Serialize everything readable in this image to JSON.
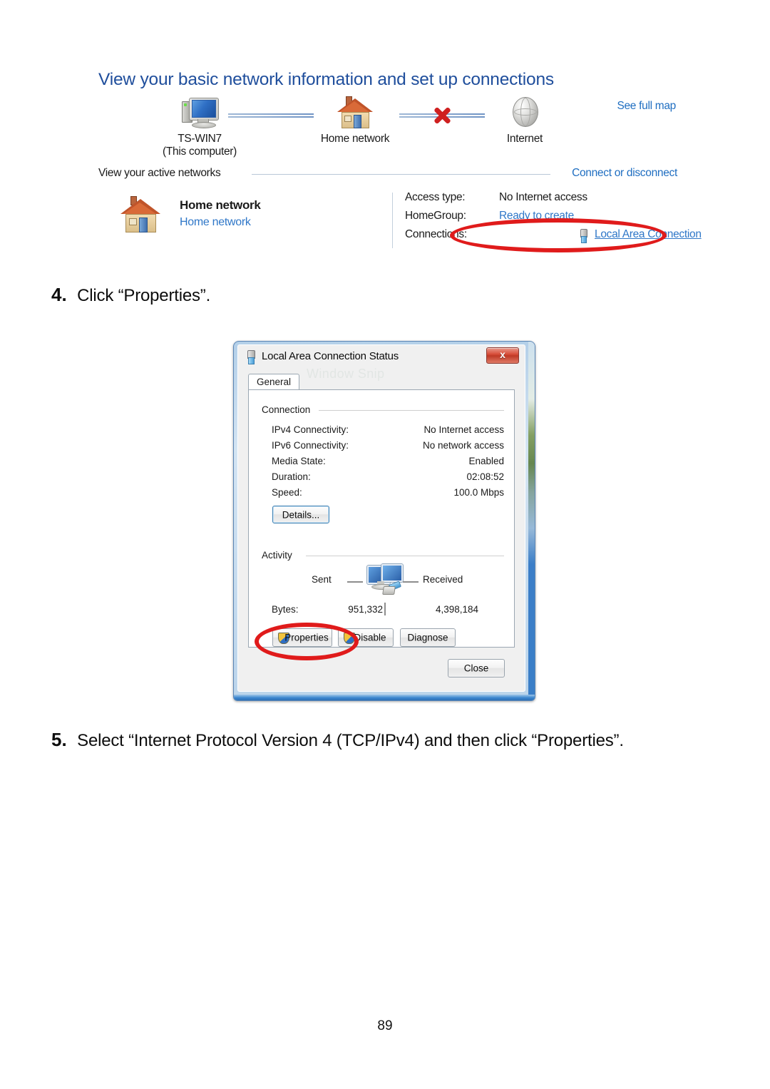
{
  "document": {
    "page_number": "89"
  },
  "network_center": {
    "heading": "View your basic network information and set up connections",
    "see_full_map": "See full map",
    "map_nodes": [
      {
        "icon": "computer-icon",
        "label": "TS-WIN7",
        "sublabel": "(This computer)"
      },
      {
        "icon": "house-icon",
        "label": "Home network",
        "sublabel": ""
      },
      {
        "icon": "globe-icon",
        "label": "Internet",
        "sublabel": ""
      }
    ],
    "connection_broken_marker": "red-x-icon",
    "active_networks_label": "View your active networks",
    "connect_or_disconnect": "Connect or disconnect",
    "active_network": {
      "icon": "house-icon",
      "name": "Home network",
      "type": "Home network",
      "facts": [
        {
          "key": "Access type:",
          "value": "No Internet access",
          "style": "plain"
        },
        {
          "key": "HomeGroup:",
          "value": "Ready to create",
          "style": "link"
        },
        {
          "key": "Connections:",
          "value": "Local Area Connection",
          "style": "link-underline",
          "icon": "lan-plug-icon"
        }
      ]
    },
    "annotation": {
      "shape": "red-ellipse",
      "target": "Local Area Connection"
    }
  },
  "steps": [
    {
      "number": "4.",
      "text": "Click “Properties”."
    },
    {
      "number": "5.",
      "text": "Select “Internet Protocol Version 4 (TCP/IPv4) and then click “Properties”."
    }
  ],
  "dialog": {
    "title": "Local Area Connection Status",
    "title_icon": "lan-plug-icon",
    "close_button": "x",
    "watermark": "Window Snip",
    "tab": "General",
    "connection_group": {
      "label": "Connection",
      "rows": [
        {
          "key": "IPv4 Connectivity:",
          "value": "No Internet access"
        },
        {
          "key": "IPv6 Connectivity:",
          "value": "No network access"
        },
        {
          "key": "Media State:",
          "value": "Enabled"
        },
        {
          "key": "Duration:",
          "value": "02:08:52"
        },
        {
          "key": "Speed:",
          "value": "100.0 Mbps"
        }
      ],
      "details_button": "Details..."
    },
    "activity_group": {
      "label": "Activity",
      "sent_label": "Sent",
      "received_label": "Received",
      "bytes_label": "Bytes:",
      "bytes_sent": "951,332",
      "bytes_received": "4,398,184"
    },
    "buttons": {
      "properties": "Properties",
      "disable": "Disable",
      "diagnose": "Diagnose",
      "close": "Close"
    },
    "annotation": {
      "shape": "red-ellipse",
      "target": "Properties / Disable buttons"
    }
  },
  "colors": {
    "heading_blue": "#1f4e9c",
    "link_blue": "#2f77c8",
    "annotation_red": "#e01b1b",
    "dialog_face": "#f0f0f0"
  }
}
